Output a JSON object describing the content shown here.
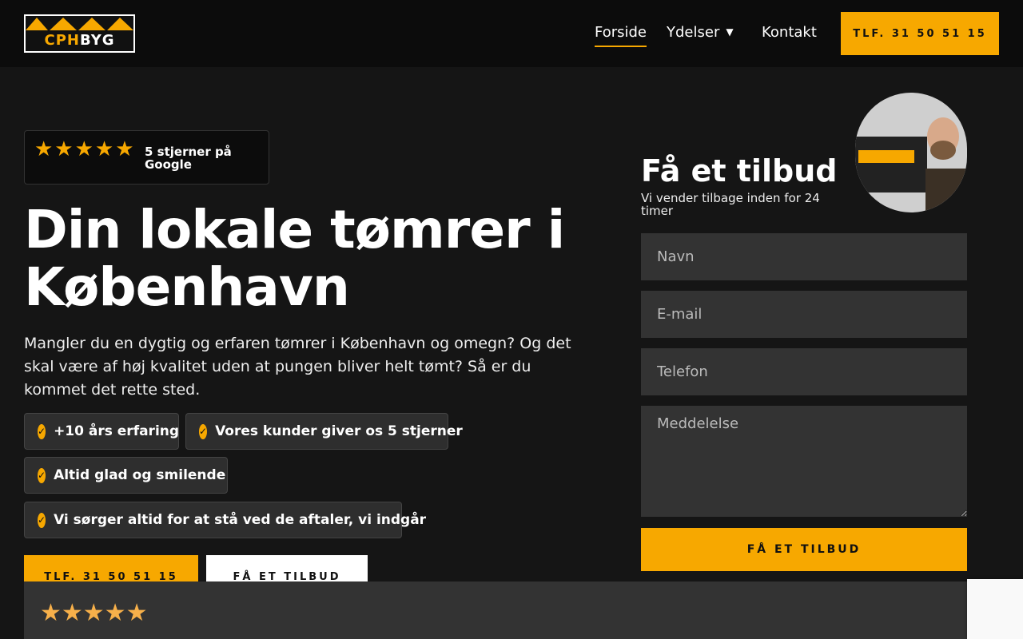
{
  "header": {
    "logo": {
      "part1": "CPH",
      "part2": "BYG"
    },
    "nav": [
      {
        "label": "Forside",
        "active": true
      },
      {
        "label": "Ydelser",
        "has_dropdown": true
      },
      {
        "label": "Kontakt"
      }
    ],
    "cta_label": "TLF. 31 50 51 15"
  },
  "hero": {
    "rating": {
      "stars": "★★★★★",
      "text": "5 stjerner på Google"
    },
    "title": "Din lokale tømrer i København",
    "description": "Mangler du en dygtig og erfaren tømrer i København og omegn? Og det skal være af høj kvalitet uden at pungen bliver helt tømt? Så er du kommet det rette sted.",
    "benefits": [
      "+10 års erfaring",
      "Vores kunder giver os 5 stjerner",
      "Altid glad og smilende",
      "Vi sørger altid for at stå ved de aftaler, vi indgår"
    ],
    "buttons": {
      "phone": "TLF. 31 50 51 15",
      "quote": "FÅ ET TILBUD"
    }
  },
  "form": {
    "title": "Få et tilbud",
    "subtitle": "Vi vender tilbage inden for 24 timer",
    "fields": {
      "name_placeholder": "Navn",
      "email_placeholder": "E-mail",
      "phone_placeholder": "Telefon",
      "message_placeholder": "Meddelelse"
    },
    "submit_label": "FÅ ET TILBUD"
  },
  "reviews": {
    "stars": "★★★★★"
  },
  "colors": {
    "accent": "#f7a800",
    "background": "#151515",
    "header": "#0c0c0c",
    "field": "#333333"
  }
}
